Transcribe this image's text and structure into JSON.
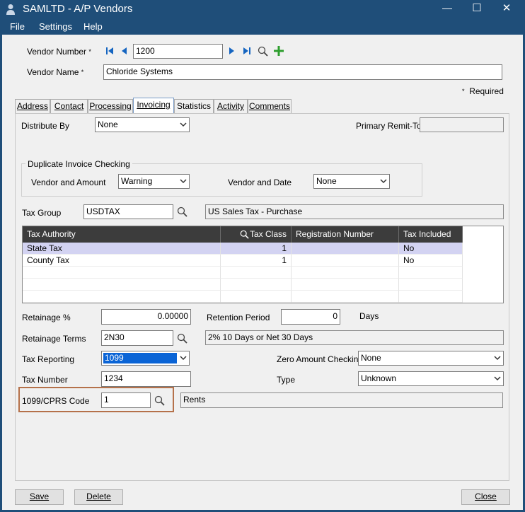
{
  "window": {
    "title": "SAMLTD - A/P Vendors",
    "minimize": "—",
    "maximize": "☐",
    "close": "✕"
  },
  "menu": {
    "file": "File",
    "settings": "Settings",
    "help": "Help"
  },
  "header": {
    "vendor_number_label": "Vendor Number",
    "vendor_number_value": "1200",
    "vendor_name_label": "Vendor Name",
    "vendor_name_value": "Chloride Systems",
    "required_marker": "*",
    "required_note": "Required"
  },
  "tabs": [
    {
      "label": "Address"
    },
    {
      "label": "Contact"
    },
    {
      "label": "Processing"
    },
    {
      "label": "Invoicing"
    },
    {
      "label": "Statistics"
    },
    {
      "label": "Activity"
    },
    {
      "label": "Comments"
    }
  ],
  "invoicing": {
    "distribute_by_label": "Distribute By",
    "distribute_by_value": "None",
    "primary_remit_to_label": "Primary Remit-To",
    "primary_remit_to_value": "",
    "dup_group_label": "Duplicate Invoice Checking",
    "vendor_amount_label": "Vendor and Amount",
    "vendor_amount_value": "Warning",
    "vendor_date_label": "Vendor and Date",
    "vendor_date_value": "None",
    "tax_group_label": "Tax Group",
    "tax_group_value": "USDTAX",
    "tax_group_desc": "US Sales Tax - Purchase",
    "tax_table": {
      "headers": [
        "Tax Authority",
        "Tax Class",
        "Registration Number",
        "Tax Included"
      ],
      "rows": [
        {
          "authority": "State Tax",
          "class": "1",
          "registration": "",
          "included": "No"
        },
        {
          "authority": "County Tax",
          "class": "1",
          "registration": "",
          "included": "No"
        }
      ]
    },
    "retainage_pct_label": "Retainage %",
    "retainage_pct_value": "0.00000",
    "retention_period_label": "Retention Period",
    "retention_period_value": "0",
    "days_label": "Days",
    "retainage_terms_label": "Retainage Terms",
    "retainage_terms_value": "2N30",
    "retainage_terms_desc": "2% 10 Days or Net 30 Days",
    "tax_reporting_label": "Tax Reporting",
    "tax_reporting_value": "1099",
    "zero_amount_label": "Zero Amount Checking",
    "zero_amount_value": "None",
    "tax_number_label": "Tax Number",
    "tax_number_value": "1234",
    "type_label": "Type",
    "type_value": "Unknown",
    "cprs_code_label": "1099/CPRS Code",
    "cprs_code_value": "1",
    "cprs_code_desc": "Rents"
  },
  "footer": {
    "save": "Save",
    "delete": "Delete",
    "close": "Close"
  },
  "colors": {
    "titlebar": "#1f4e79",
    "grid_header": "#3c3c3c",
    "selected_row": "#d3d3f2",
    "highlight_box": "#b5714a",
    "nav_arrow": "#1565c0",
    "add_icon": "#2e9e2e",
    "selection": "#0a64d6"
  }
}
